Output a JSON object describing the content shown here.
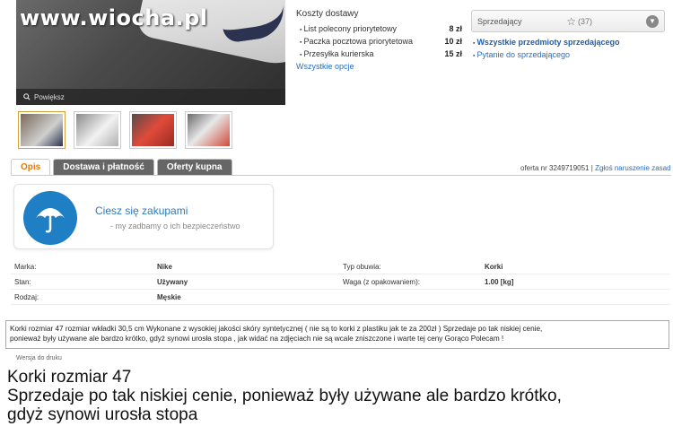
{
  "photo": {
    "watermark": "www.wiocha.pl",
    "zoom_label": "Powiększ"
  },
  "shipping": {
    "title": "Koszty dostawy",
    "rows": [
      {
        "name": "List polecony priorytetowy",
        "price": "8 zł"
      },
      {
        "name": "Paczka pocztowa priorytetowa",
        "price": "10 zł"
      },
      {
        "name": "Przesyłka kurierska",
        "price": "15 zł"
      }
    ],
    "all_options": "Wszystkie opcje"
  },
  "seller": {
    "label": "Sprzedający",
    "rating_count": "(37)",
    "link_all": "Wszystkie przedmioty sprzedającego",
    "link_ask": "Pytanie do sprzedającego"
  },
  "tabs": [
    {
      "label": "Opis"
    },
    {
      "label": "Dostawa i płatność"
    },
    {
      "label": "Oferty kupna"
    }
  ],
  "offer": {
    "number": "oferta nr 3249719051",
    "separator": "|",
    "report": "Zgłoś naruszenie zasad"
  },
  "protection": {
    "headline": "Ciesz się zakupami",
    "subline": "my zadbamy o ich bezpieczeństwo"
  },
  "params": [
    {
      "k1": "Marka:",
      "v1": "Nike",
      "k2": "Typ obuwia:",
      "v2": "Korki"
    },
    {
      "k1": "Stan:",
      "v1": "Używany",
      "k2": "Waga (z opakowaniem):",
      "v2": "1.00 [kg]"
    },
    {
      "k1": "Rodzaj:",
      "v1": "Męskie",
      "k2": "",
      "v2": ""
    }
  ],
  "description": {
    "line1": "Korki rozmiar 47 rozmiar wkładki 30,5 cm Wykonane z wysokiej jakości skóry syntetycznej ( nie są to korki z plastiku jak te za 200zł ) Sprzedaje po tak niskiej cenie,",
    "line2": "ponieważ były używane ale bardzo krótko, gdyż synowi urosła stopa , jak widać na zdjęciach nie są wcale zniszczone i warte tej ceny Gorąco Polecam !"
  },
  "print_link": "Wersja do druku",
  "caption": {
    "line1": "Korki rozmiar 47",
    "line2": "Sprzedaje po tak niskiej cenie, ponieważ były używane ale bardzo krótko,",
    "line3": "gdyż synowi urosła stopa"
  },
  "colors": {
    "accent_orange": "#e07a10",
    "link_blue": "#2a6ebb",
    "badge_blue": "#1f7fc4"
  }
}
